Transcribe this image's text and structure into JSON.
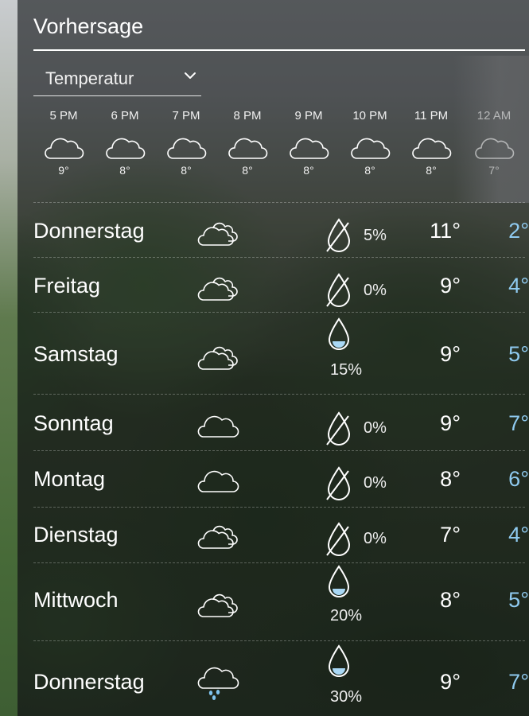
{
  "title": "Vorhersage",
  "dropdown": {
    "selected": "Temperatur"
  },
  "hourly": [
    {
      "time": "5 PM",
      "temp": "9°",
      "icon": "cloud-icon"
    },
    {
      "time": "6 PM",
      "temp": "8°",
      "icon": "cloud-icon"
    },
    {
      "time": "7 PM",
      "temp": "8°",
      "icon": "cloud-icon"
    },
    {
      "time": "8 PM",
      "temp": "8°",
      "icon": "cloud-icon"
    },
    {
      "time": "9 PM",
      "temp": "8°",
      "icon": "cloud-icon"
    },
    {
      "time": "10 PM",
      "temp": "8°",
      "icon": "cloud-icon"
    },
    {
      "time": "11 PM",
      "temp": "8°",
      "icon": "cloud-icon"
    },
    {
      "time": "12 AM",
      "temp": "7°",
      "icon": "cloud-icon"
    }
  ],
  "daily": [
    {
      "day": "Donnerstag",
      "icon": "clouds-icon",
      "precip": "5%",
      "precip_icon": "no-rain-drop-icon",
      "high": "11°",
      "low": "2°"
    },
    {
      "day": "Freitag",
      "icon": "clouds-icon",
      "precip": "0%",
      "precip_icon": "no-rain-drop-icon",
      "high": "9°",
      "low": "4°"
    },
    {
      "day": "Samstag",
      "icon": "clouds-icon",
      "precip": "15%",
      "precip_icon": "rain-drop-icon",
      "high": "9°",
      "low": "5°"
    },
    {
      "day": "Sonntag",
      "icon": "cloud-icon",
      "precip": "0%",
      "precip_icon": "no-rain-drop-icon",
      "high": "9°",
      "low": "7°"
    },
    {
      "day": "Montag",
      "icon": "cloud-icon",
      "precip": "0%",
      "precip_icon": "no-rain-drop-icon",
      "high": "8°",
      "low": "6°"
    },
    {
      "day": "Dienstag",
      "icon": "clouds-icon",
      "precip": "0%",
      "precip_icon": "no-rain-drop-icon",
      "high": "7°",
      "low": "4°"
    },
    {
      "day": "Mittwoch",
      "icon": "clouds-icon",
      "precip": "20%",
      "precip_icon": "rain-drop-icon",
      "high": "8°",
      "low": "5°"
    },
    {
      "day": "Donnerstag",
      "icon": "rain-cloud-icon",
      "precip": "30%",
      "precip_icon": "rain-drop-icon",
      "high": "9°",
      "low": "7°"
    }
  ],
  "colors": {
    "low_temp": "#8fcaf0",
    "drop_fill": "#a9d8f5",
    "rain_dots": "#7fc4f0"
  }
}
